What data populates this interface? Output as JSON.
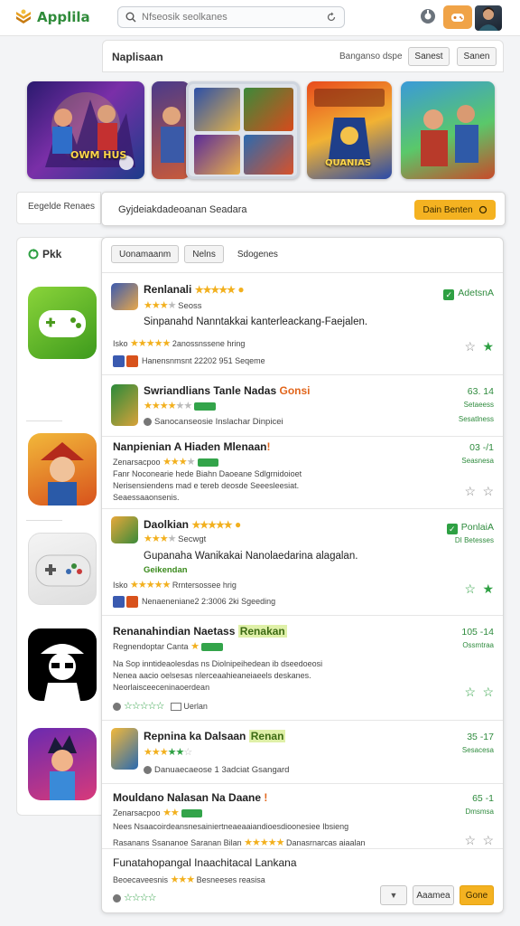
{
  "header": {
    "app_name": "Applila",
    "search_placeholder": "Nfseosik seolkanes",
    "colors": {
      "brand": "#2f8b3a",
      "accent": "#f0a347"
    }
  },
  "featured": {
    "title": "Naplisaan",
    "sort_label": "Banganso dspe",
    "buttons": [
      "Sanest",
      "Sanen"
    ],
    "banners": [
      {
        "text": "OWM HUS"
      },
      {
        "text": ""
      },
      {
        "text": ""
      },
      {
        "text": "QUANIAS"
      },
      {
        "text": ""
      }
    ]
  },
  "promo": {
    "left_label": "Eegelde Renaes",
    "text": "Gyjdeiakdadeoanan Seadara",
    "button_label": "Dain Benten"
  },
  "leftcol": {
    "label": "Pkk"
  },
  "tabs": [
    "Uonamaanm",
    "Nelns",
    "Sdogenes"
  ],
  "rows": [
    {
      "title": "Renlanali",
      "rating_text": "Seoss",
      "status": "AdetsnA",
      "desc": "Sinpanahd Nanntakkai kanterleackang-Faejalen.",
      "meta_stars_text": "2anossnssene hring",
      "meta_label": "Isko",
      "bottom_text": "Hanensnmsnt 22202 951 Seqeme"
    },
    {
      "title": "Swriandlians Tanle Nadas",
      "title_highlight": "Gonsi",
      "status": "63. 14",
      "status_sub": "Setaeess",
      "sub_text": "Sanocanseosie Inslachar Dinpicei",
      "status_sub2": "Sesatlness"
    },
    {
      "title": "Nanpienian A Hiaden Mlenaan",
      "title_highlight": "!",
      "sub_text": "Zenarsacpoo",
      "status": "03 -/1",
      "status_sub": "Seasnesa",
      "lines": [
        "Fanr Noconearie hede Biahn Daoeane Sdlgrnidoioet",
        "Nerisensiendens mad e tereb deosde Seeesleesiat.",
        "Seaessaaonsenis."
      ]
    },
    {
      "title": "Daolkian",
      "status": "PonlaiA",
      "status_sub": "DI Betesses",
      "rating_text": "Secwgt",
      "desc": "Gupanaha Wanikakai Nanolaedarina alagalan.",
      "desc_sub": "Geikendan",
      "meta_stars_text": "Rrntersossee hrig",
      "meta_label": "Isko",
      "bottom_text": "Nenaeneniane2 2:3006 2ki Sgeeding"
    },
    {
      "title": "Renanahindian Naetass",
      "title_highlight": "Renakan",
      "sub_text": "Regnendoptar Canta",
      "status": "105 -14",
      "status_sub": "Ossmtraa",
      "lines": [
        "Na Sop inntideaolesdas ns Diolnipeihedean ib dseedoeosi",
        "Nenea aacio oelsesas nlerceaahieaneiaeels deskanes.",
        "Neorlaisceeceninaoerdean"
      ],
      "bottom_text": "Uerlan"
    },
    {
      "title": "Repnina ka Dalsaan",
      "title_highlight": "Renan",
      "status": "35 -17",
      "status_sub": "Sesacesa",
      "bottom_text": "Danuaecaeose 1 3adciat Gsangard"
    },
    {
      "title": "Mouldano Nalasan Na Daane",
      "title_highlight": "!",
      "status": "65 -1",
      "status_sub": "Dmsmsa",
      "sub_text": "Zenarsacpoo",
      "lines": [
        "Nees Nsaacoirdeansnesainiertneaeaaiandioesdioonesiee Ibsieng",
        "Rasanans Ssananoe Saranan Bilan"
      ],
      "meta_stars_text": "Danasrnarcas aiaalan"
    },
    {
      "title": "Funatahopangal Inaachitacal Lankana",
      "sub_text": "Beoecaveesnis",
      "sub_text2": "Besneeses reasisa"
    }
  ],
  "footer": {
    "buttons": [
      "",
      "Aaamea",
      "Gone"
    ]
  },
  "status_colors": {
    "green": "#2ea043",
    "orange": "#f4b221"
  }
}
